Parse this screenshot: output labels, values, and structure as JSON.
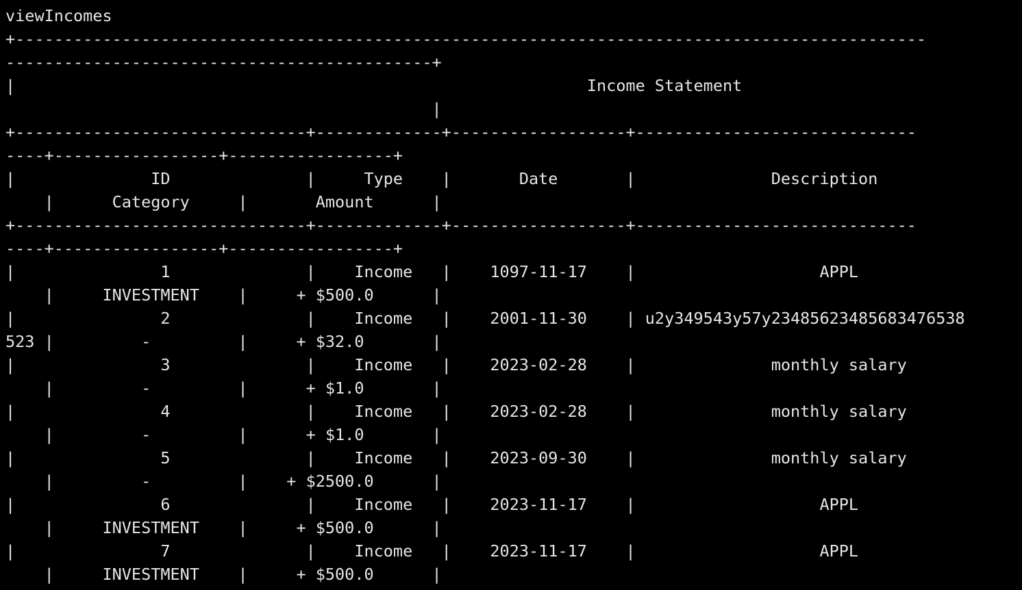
{
  "terminal": {
    "colors": {
      "background": "#000000",
      "foreground": "#e6e6e6"
    },
    "lines": [
      "viewIncomes",
      "+----------------------------------------------------------------------------------------------",
      "--------------------------------------------+",
      "|                                                           Income Statement",
      "                                            |",
      "+------------------------------+-------------+------------------+-----------------------------",
      "----+-----------------+-----------------+",
      "|              ID              |     Type    |       Date       |              Description",
      "    |      Category     |       Amount      |",
      "+------------------------------+-------------+------------------+-----------------------------",
      "----+-----------------+-----------------+",
      "|               1              |    Income   |    1097-11-17    |                   APPL",
      "    |     INVESTMENT    |     + $500.0      |",
      "|               2              |    Income   |    2001-11-30    | u2y349543y57y23485623485683476538",
      "523 |         -         |     + $32.0       |",
      "|               3              |    Income   |    2023-02-28    |              monthly salary",
      "    |         -         |      + $1.0       |",
      "|               4              |    Income   |    2023-02-28    |              monthly salary",
      "    |         -         |      + $1.0       |",
      "|               5              |    Income   |    2023-09-30    |              monthly salary",
      "    |         -         |    + $2500.0      |",
      "|               6              |    Income   |    2023-11-17    |                   APPL",
      "    |     INVESTMENT    |     + $500.0      |",
      "|               7              |    Income   |    2023-11-17    |                   APPL",
      "    |     INVESTMENT    |     + $500.0      |"
    ]
  }
}
